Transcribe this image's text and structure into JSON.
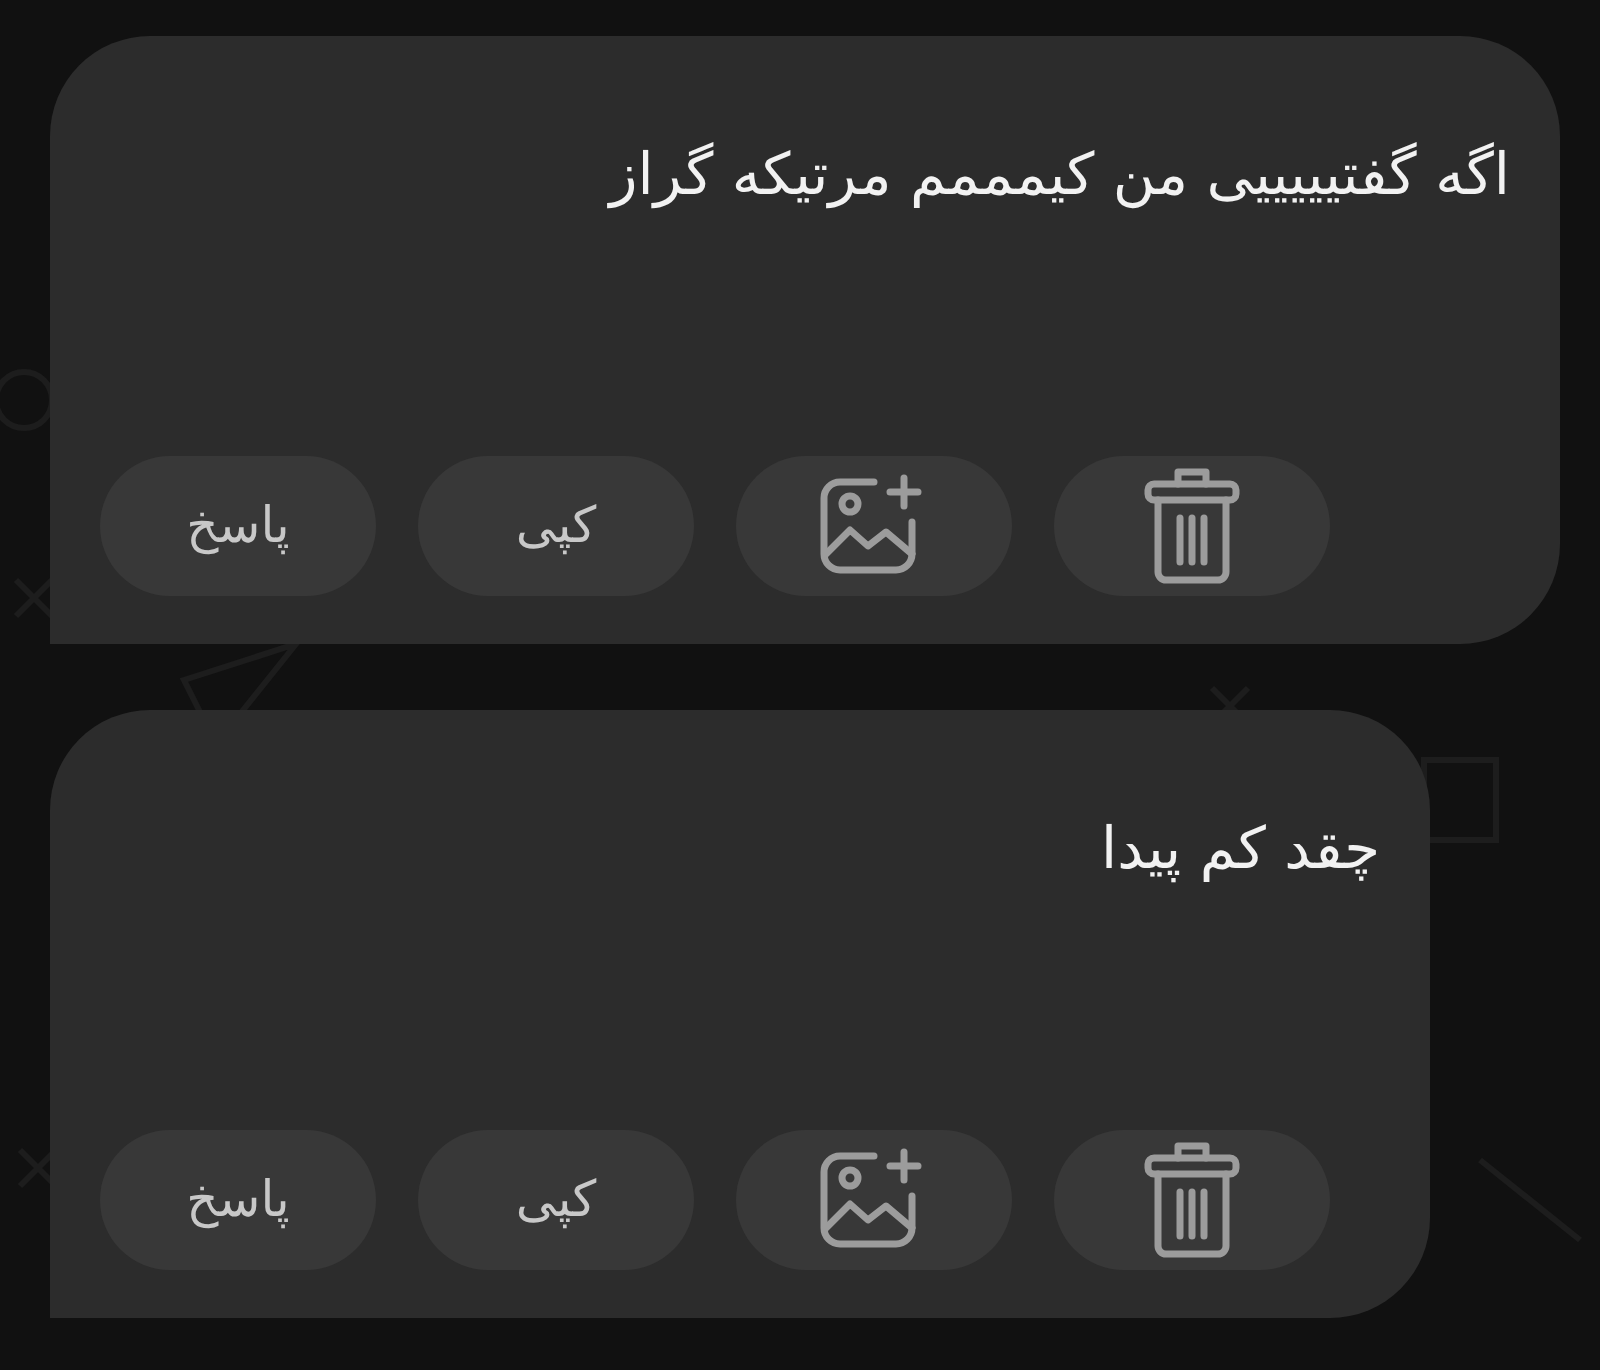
{
  "messages": [
    {
      "text": "اگه گفتیییییی من کیمممم مرتیکه گراز",
      "actions": [
        {
          "kind": "delete"
        },
        {
          "kind": "add-image"
        },
        {
          "kind": "copy",
          "label": "کپی"
        },
        {
          "kind": "reply",
          "label": "پاسخ"
        }
      ]
    },
    {
      "text": "چقد کم پیدا",
      "actions": [
        {
          "kind": "delete"
        },
        {
          "kind": "add-image"
        },
        {
          "kind": "copy",
          "label": "کپی"
        },
        {
          "kind": "reply",
          "label": "پاسخ"
        }
      ]
    }
  ]
}
